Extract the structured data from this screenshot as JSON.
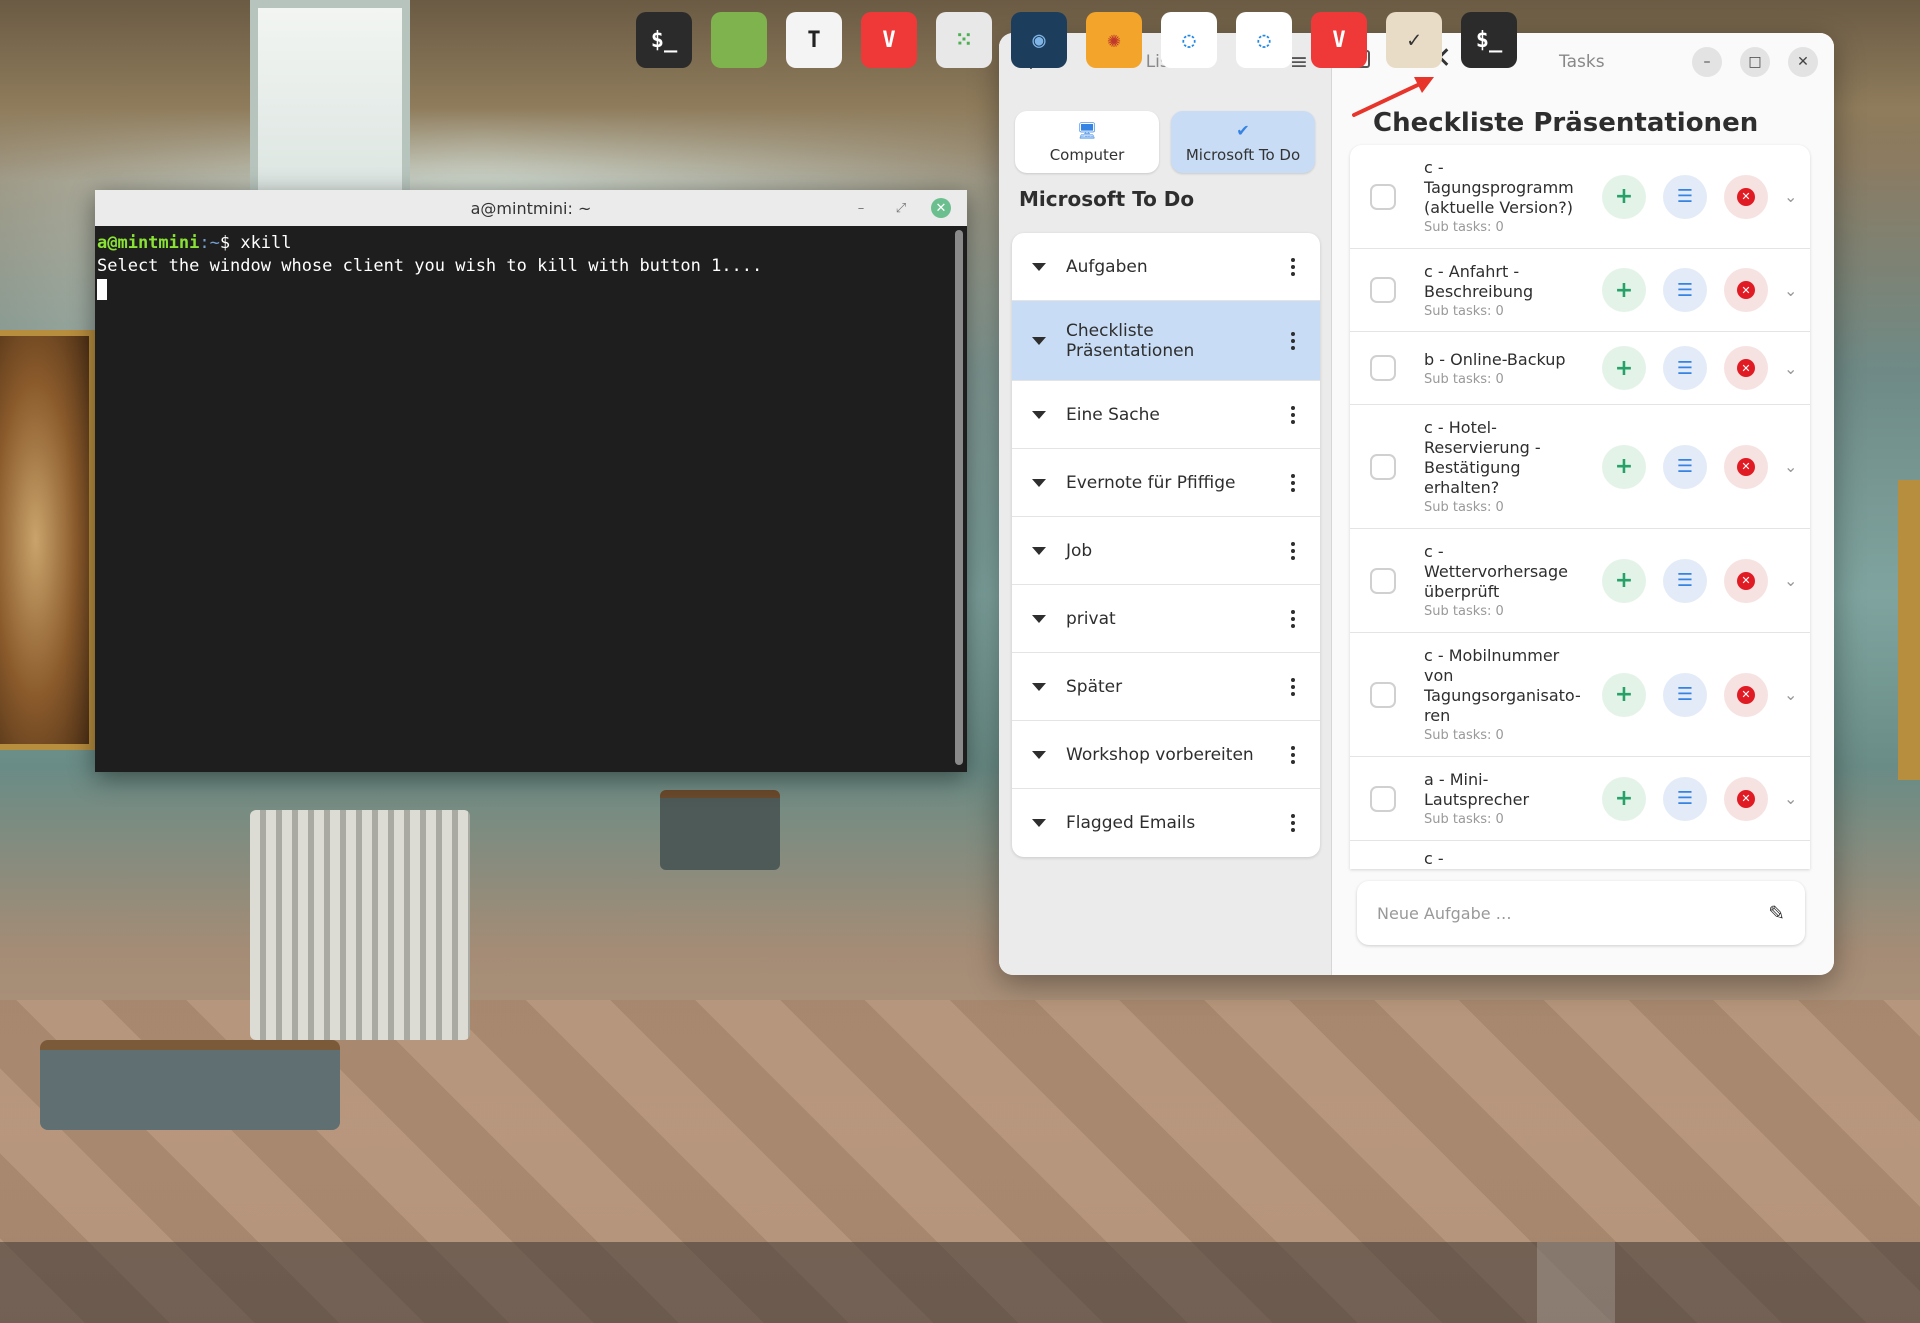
{
  "terminal": {
    "title": "a@mintmini: ~",
    "prompt_user": "a@mintmini",
    "prompt_path": ":~",
    "prompt_symbol": "$ ",
    "command": "xkill",
    "output": "Select the window whose client you wish to kill with button 1...."
  },
  "lists_pane": {
    "title": "Lists",
    "providers": [
      {
        "label": "Computer",
        "icon": "computer-icon",
        "active": false
      },
      {
        "label": "Microsoft To Do",
        "icon": "checkmark-icon",
        "active": true
      }
    ],
    "account_title": "Microsoft To Do",
    "lists": [
      {
        "label": "Aufgaben"
      },
      {
        "label": "Checkliste Präsentationen",
        "active": true
      },
      {
        "label": "Eine Sache"
      },
      {
        "label": "Evernote für Pfiffige"
      },
      {
        "label": "Job"
      },
      {
        "label": "privat"
      },
      {
        "label": "Später"
      },
      {
        "label": "Workshop vorbereiten"
      },
      {
        "label": "Flagged Emails"
      }
    ]
  },
  "tasks_pane": {
    "title": "Tasks",
    "heading": "Checkliste Präsentationen",
    "tasks": [
      {
        "title": "c - Tagungsprogramm (aktuelle Version?)",
        "sub": "Sub tasks: 0"
      },
      {
        "title": "c - Anfahrt - Beschreibung",
        "sub": "Sub tasks: 0"
      },
      {
        "title": "b - Online-Backup",
        "sub": "Sub tasks: 0"
      },
      {
        "title": "c - Hotel-Reservierung - Bestätigung erhalten?",
        "sub": "Sub tasks: 0"
      },
      {
        "title": "c - Wettervorhersage überprüft",
        "sub": "Sub tasks: 0"
      },
      {
        "title": "c - Mobilnummer von Tagungsorganisato-ren",
        "sub": "Sub tasks: 0"
      },
      {
        "title": "a - Mini-Lautsprecher",
        "sub": "Sub tasks: 0"
      },
      {
        "title": "c -",
        "sub": ""
      }
    ],
    "new_task_placeholder": "Neue Aufgabe …"
  },
  "dock": {
    "apps": [
      {
        "name": "terminal",
        "glyph": "$_",
        "bg": "#2b2b2b",
        "fg": "#ffffff"
      },
      {
        "name": "files",
        "glyph": "",
        "bg": "#7fb34d",
        "fg": "#ffffff"
      },
      {
        "name": "text-editor",
        "glyph": "T",
        "bg": "#f4f4f4",
        "fg": "#222222"
      },
      {
        "name": "vivaldi",
        "glyph": "V",
        "bg": "#ef3939",
        "fg": "#ffffff"
      },
      {
        "name": "apps-grid",
        "glyph": "⁙",
        "bg": "#e8e8e8",
        "fg": "#4caf50"
      },
      {
        "name": "lens",
        "glyph": "◉",
        "bg": "#1d3d5c",
        "fg": "#7fb4e6"
      },
      {
        "name": "xnview",
        "glyph": "✺",
        "bg": "#f3a52b",
        "fg": "#c0392b"
      },
      {
        "name": "sync-1",
        "glyph": "◌",
        "bg": "#ffffff",
        "fg": "#1e88e5"
      },
      {
        "name": "sync-2",
        "glyph": "◌",
        "bg": "#ffffff",
        "fg": "#1e88e5"
      },
      {
        "name": "vivaldi-2",
        "glyph": "V",
        "bg": "#ef3939",
        "fg": "#ffffff"
      },
      {
        "name": "tasks",
        "glyph": "✓",
        "bg": "#e9dcc6",
        "fg": "#333333"
      },
      {
        "name": "terminal-2",
        "glyph": "$_",
        "bg": "#2b2b2b",
        "fg": "#ffffff"
      }
    ]
  }
}
